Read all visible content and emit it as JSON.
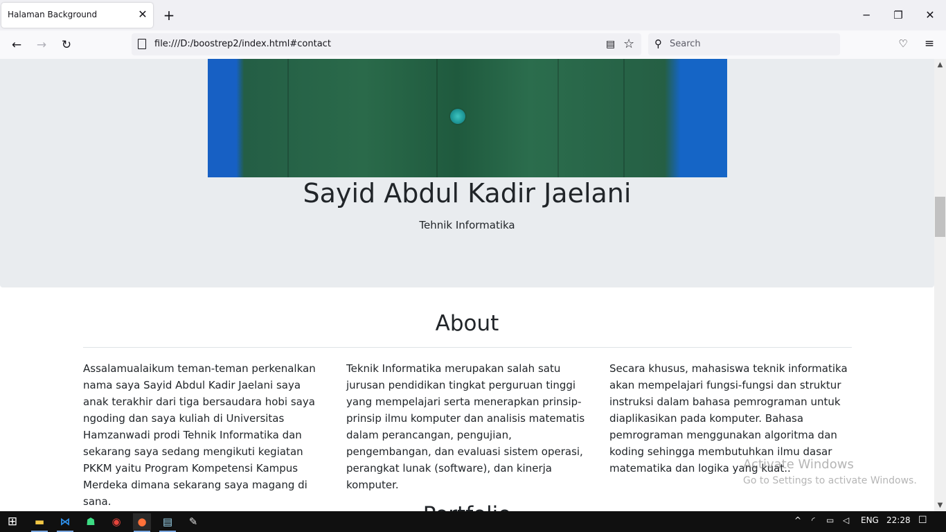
{
  "browser": {
    "tab_title": "Halaman Background",
    "tab_close": "✕",
    "new_tab": "+",
    "url": "file:///D:/boostrep2/index.html#contact",
    "search_placeholder": "Search",
    "window_min": "─",
    "window_max": "❐",
    "window_close": "✕",
    "back": "←",
    "forward": "→",
    "reload": "↻",
    "icons": [
      "page-icon",
      "reader-view-icon",
      "bookmark-star-icon",
      "search-icon",
      "pocket-icon",
      "hamburger-menu-icon"
    ]
  },
  "profile": {
    "name": "Sayid Abdul Kadir Jaelani",
    "major": "Tehnik Informatika"
  },
  "about": {
    "title": "About",
    "columns": [
      "Assalamualaikum teman-teman perkenalkan nama saya Sayid Abdul Kadir Jaelani saya anak terakhir dari tiga bersaudara hobi saya ngoding dan saya kuliah di Universitas Hamzanwadi prodi Tehnik Informatika dan sekarang saya sedang mengikuti kegiatan PKKM yaitu Program Kompetensi Kampus Merdeka dimana sekarang saya magang di sana.",
      "Teknik Informatika merupakan salah satu jurusan pendidikan tingkat perguruan tinggi yang mempelajari serta menerapkan prinsip-prinsip ilmu komputer dan analisis matematis dalam perancangan, pengujian, pengembangan, dan evaluasi sistem operasi, perangkat lunak (software), dan kinerja komputer.",
      "Secara khusus, mahasiswa teknik informatika akan mempelajari fungsi-fungsi dan struktur instruksi dalam bahasa pemrograman untuk diaplikasikan pada komputer. Bahasa pemrograman menggunakan algoritma dan koding sehingga membutuhkan ilmu dasar matematika dan logika yang kuat.."
    ]
  },
  "portfolio": {
    "title": "Portfolio"
  },
  "watermark": {
    "line1": "Activate Windows",
    "line2": "Go to Settings to activate Windows."
  },
  "taskbar": {
    "language": "ENG",
    "time": "22:28"
  },
  "colors": {
    "jumbotron_bg": "#e9ecef",
    "photo_blue": "#1760c4",
    "jacket_green": "#2a6a4a",
    "text": "#212529"
  }
}
